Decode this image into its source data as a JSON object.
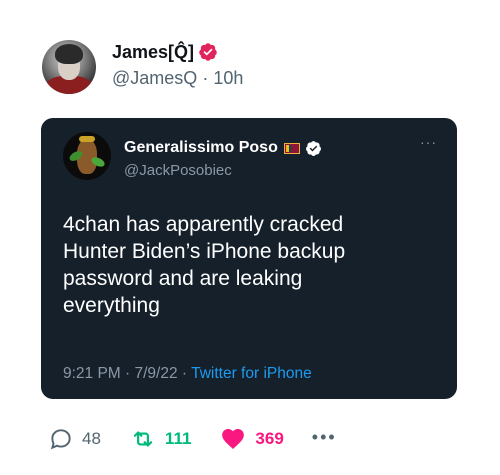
{
  "tweet": {
    "author": {
      "display_name": "James[Q̂]",
      "handle": "@JamesQ",
      "time": "10h",
      "separator": "·"
    },
    "quoted": {
      "display_name": "Generalissimo Poso",
      "handle": "@JackPosobiec",
      "text": "4chan has apparently cracked\nHunter Biden’s iPhone backup\npassword and are leaking\neverything",
      "timestamp": "9:21 PM · 7/9/22",
      "meta_separator": " · ",
      "source": "Twitter for iPhone",
      "more_label": "···"
    },
    "actions": {
      "replies": "48",
      "retweets": "111",
      "likes": "369",
      "more_label": "•••"
    }
  },
  "colors": {
    "verified": "#e0245e",
    "quoted_verified": "#ffffff",
    "card_bg": "#15202b",
    "retweet": "#00ba7c",
    "like": "#f91880",
    "link": "#1d9bf0"
  },
  "icons": {
    "verified": "verified-badge-icon",
    "flag": "sri-lanka-flag-icon",
    "reply": "reply-icon",
    "retweet": "retweet-icon",
    "like": "heart-icon",
    "more": "more-icon"
  }
}
